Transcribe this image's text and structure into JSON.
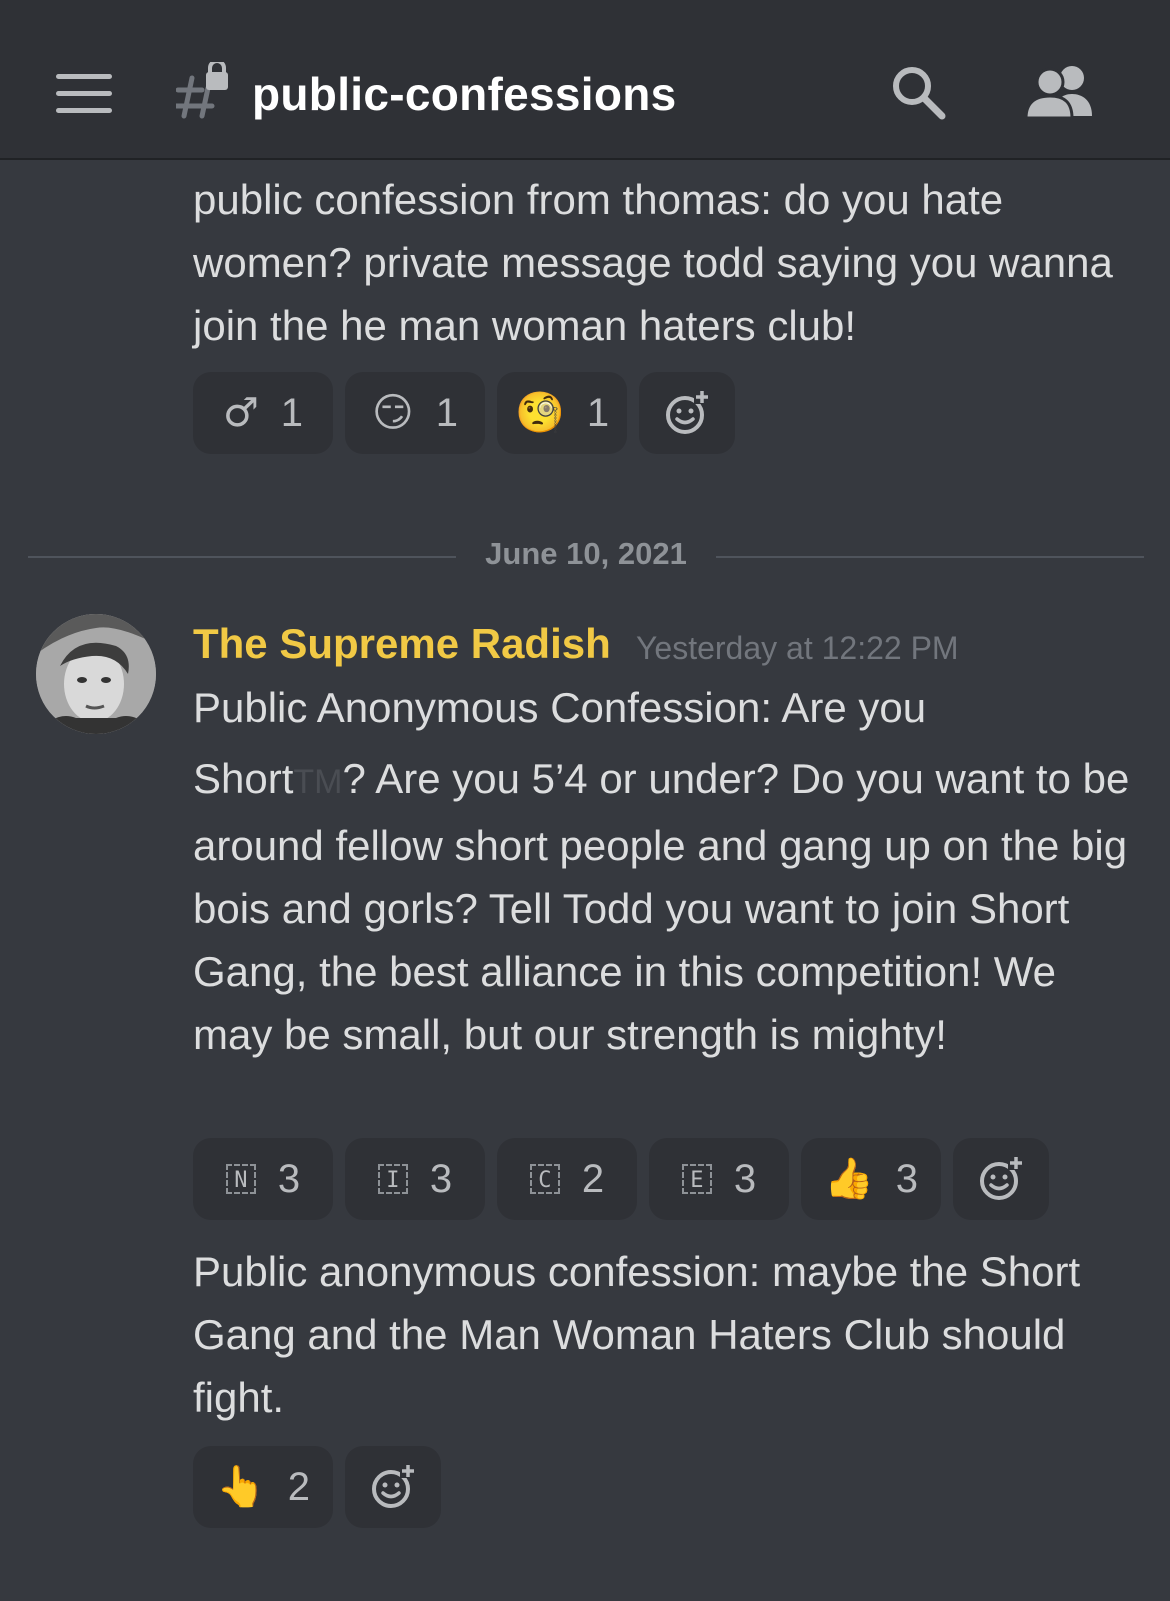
{
  "header": {
    "channel_name": "public-confessions",
    "menu_icon": "hamburger-menu-icon",
    "channel_icon": "locked-text-channel-icon",
    "search_icon": "search-icon",
    "members_icon": "members-icon"
  },
  "messages": [
    {
      "text": "public confession from thomas: do you hate women? private message todd saying you wanna join the he man woman haters club!",
      "reactions": [
        {
          "emoji": "♂",
          "icon": "male-sign-icon",
          "count": "1"
        },
        {
          "emoji": "😏",
          "icon": "smirk-face-icon",
          "count": "1"
        },
        {
          "emoji": "🧐",
          "icon": "custom-face-emoji-icon",
          "count": "1"
        }
      ]
    }
  ],
  "divider": {
    "date": "June 10, 2021"
  },
  "post": {
    "author": "The Supreme Radish",
    "author_color": "#f1c945",
    "timestamp": "Yesterday at 12:22 PM",
    "line1": "Public Anonymous Confession: Are you",
    "short_word": "Short",
    "tm": "TM",
    "body_rest": "? Are you 5’4 or under? Do you want to be around fellow short people and gang up on the big bois and gorls? Tell Todd you want to join Short Gang, the best alliance in this competition! We may be small, but our strength is mighty!",
    "reactions": [
      {
        "letter": "N",
        "icon": "regional-indicator-n-icon",
        "count": "3"
      },
      {
        "letter": "I",
        "icon": "regional-indicator-i-icon",
        "count": "3"
      },
      {
        "letter": "C",
        "icon": "regional-indicator-c-icon",
        "count": "2"
      },
      {
        "letter": "E",
        "icon": "regional-indicator-e-icon",
        "count": "3"
      },
      {
        "emoji": "👍",
        "icon": "thumbs-up-icon",
        "count": "3"
      }
    ],
    "followup_text": "Public anonymous confession: maybe the Short Gang and the Man Woman Haters Club should fight.",
    "followup_reactions": [
      {
        "emoji": "👆",
        "icon": "pointing-up-icon",
        "count": "2"
      }
    ]
  }
}
